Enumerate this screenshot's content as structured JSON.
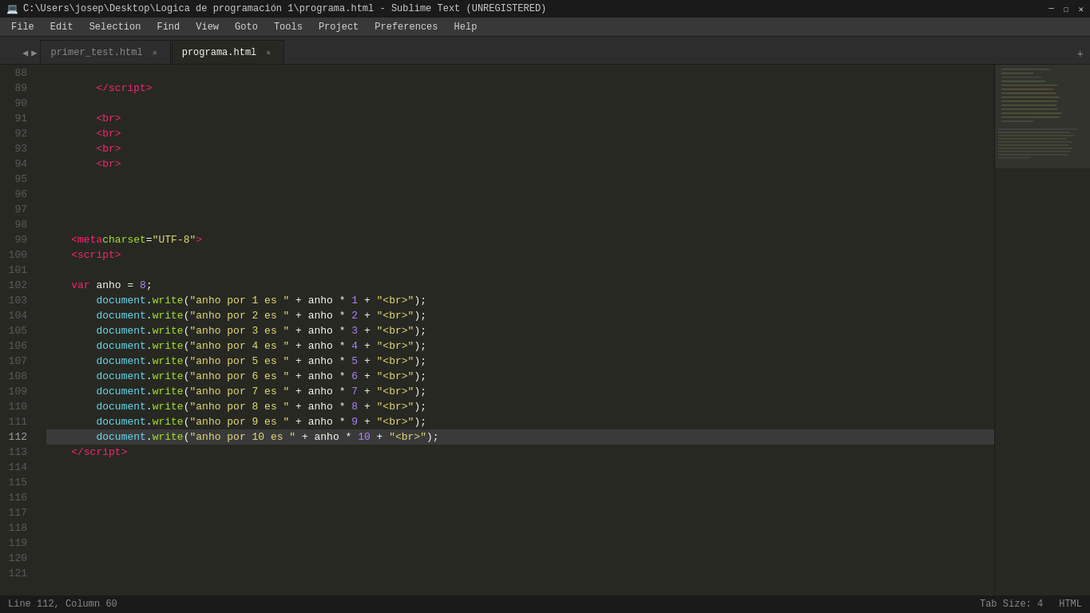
{
  "titleBar": {
    "title": "C:\\Users\\josep\\Desktop\\Logica de programación 1\\programa.html - Sublime Text (UNREGISTERED)",
    "icon": "💻",
    "controls": [
      "─",
      "☐",
      "✕"
    ]
  },
  "menuBar": {
    "items": [
      "File",
      "Edit",
      "Selection",
      "Find",
      "View",
      "Goto",
      "Tools",
      "Project",
      "Preferences",
      "Help"
    ]
  },
  "tabs": [
    {
      "id": "tab1",
      "label": "primer_test.html",
      "active": false
    },
    {
      "id": "tab2",
      "label": "programa.html",
      "active": true
    }
  ],
  "statusBar": {
    "position": "Line 112, Column 60",
    "tabSize": "Tab Size: 4",
    "language": "HTML"
  },
  "editor": {
    "startLine": 88,
    "activeLine": 112
  }
}
